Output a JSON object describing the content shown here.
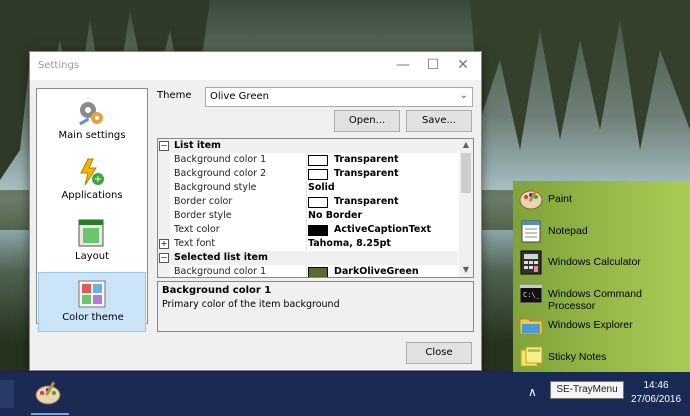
{
  "window": {
    "title": "Settings",
    "controls": {
      "minimize": "—",
      "maximize": "☐",
      "close": "✕"
    }
  },
  "nav": {
    "items": [
      {
        "label": "Main settings",
        "icon": "gears-icon"
      },
      {
        "label": "Applications",
        "icon": "lightning-add-icon"
      },
      {
        "label": "Layout",
        "icon": "layout-icon"
      },
      {
        "label": "Color theme",
        "icon": "color-swatches-icon",
        "selected": true
      }
    ]
  },
  "theme": {
    "label": "Theme",
    "value": "Olive Green",
    "open_label": "Open...",
    "save_label": "Save..."
  },
  "grid": {
    "rows": [
      {
        "type": "category",
        "name": "List item",
        "toggle": "−"
      },
      {
        "type": "prop",
        "name": "Background color 1",
        "value": "Transparent",
        "swatch": "#ffffff"
      },
      {
        "type": "prop",
        "name": "Background color 2",
        "value": "Transparent",
        "swatch": "#ffffff"
      },
      {
        "type": "prop",
        "name": "Background style",
        "value": "Solid"
      },
      {
        "type": "prop",
        "name": "Border color",
        "value": "Transparent",
        "swatch": "#ffffff"
      },
      {
        "type": "prop",
        "name": "Border style",
        "value": "No Border"
      },
      {
        "type": "prop",
        "name": "Text color",
        "value": "ActiveCaptionText",
        "swatch": "#000000"
      },
      {
        "type": "expand",
        "name": "Text font",
        "value": "Tahoma, 8.25pt",
        "toggle": "+"
      },
      {
        "type": "category",
        "name": "Selected list item",
        "toggle": "−"
      },
      {
        "type": "prop",
        "name": "Background color 1",
        "value": "DarkOliveGreen",
        "swatch": "#556b2f"
      }
    ]
  },
  "description": {
    "title": "Background color 1",
    "text": "Primary color of the item background"
  },
  "close_label": "Close",
  "tray_menu": {
    "items": [
      {
        "label": "Paint",
        "icon": "paint-palette-icon"
      },
      {
        "label": "Notepad",
        "icon": "notepad-icon"
      },
      {
        "label": "Windows Calculator",
        "icon": "calculator-icon"
      },
      {
        "label": "Windows Command Processor",
        "icon": "cmd-icon"
      },
      {
        "label": "Windows Explorer",
        "icon": "folder-icon"
      },
      {
        "label": "Sticky Notes",
        "icon": "sticky-notes-icon"
      }
    ]
  },
  "taskbar": {
    "tooltip": "SE-TrayMenu",
    "time": "14:46",
    "date": "27/06/2016",
    "overflow_chevron": "∧"
  },
  "colors": {
    "tray_bg_start": "#7fa23a",
    "tray_bg_end": "#a9cc56",
    "taskbar": "#1a2a55",
    "selected_nav": "#cce4f7"
  }
}
